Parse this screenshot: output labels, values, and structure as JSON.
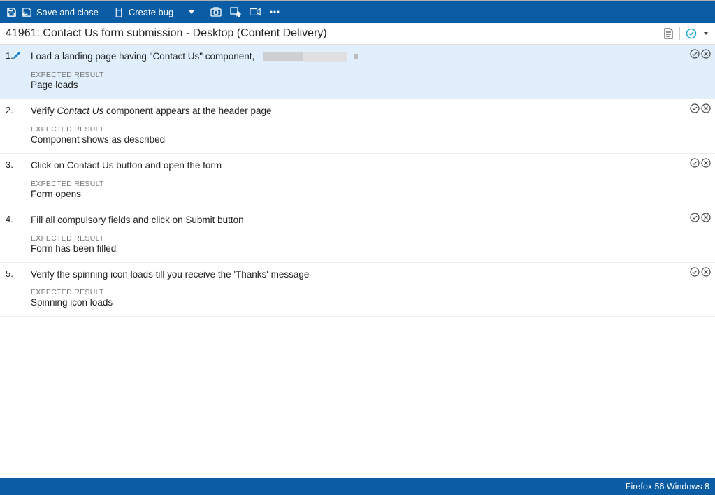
{
  "toolbar": {
    "save_close": "Save and close",
    "create_bug": "Create bug"
  },
  "title": "41961: Contact Us form submission - Desktop (Content Delivery)",
  "expected_label": "EXPECTED RESULT",
  "steps": [
    {
      "num": "1.",
      "instr_pre": "Load a landing page having \"Contact Us\" component, ",
      "expected": "Page loads",
      "active": true,
      "redacted": true
    },
    {
      "num": "2.",
      "instr_pre": "Verify ",
      "instr_em": "Contact Us",
      "instr_post": " component appears at the header page",
      "expected": "Component shows as described"
    },
    {
      "num": "3.",
      "instr_pre": "Click on Contact Us button and open the form",
      "expected": "Form opens"
    },
    {
      "num": "4.",
      "instr_pre": "Fill all compulsory fields and click on Submit button",
      "expected": "Form has been filled"
    },
    {
      "num": "5.",
      "instr_pre": "Verify the spinning icon loads till you receive the 'Thanks' message",
      "expected": "Spinning icon loads"
    }
  ],
  "status": "Firefox 56 Windows 8"
}
